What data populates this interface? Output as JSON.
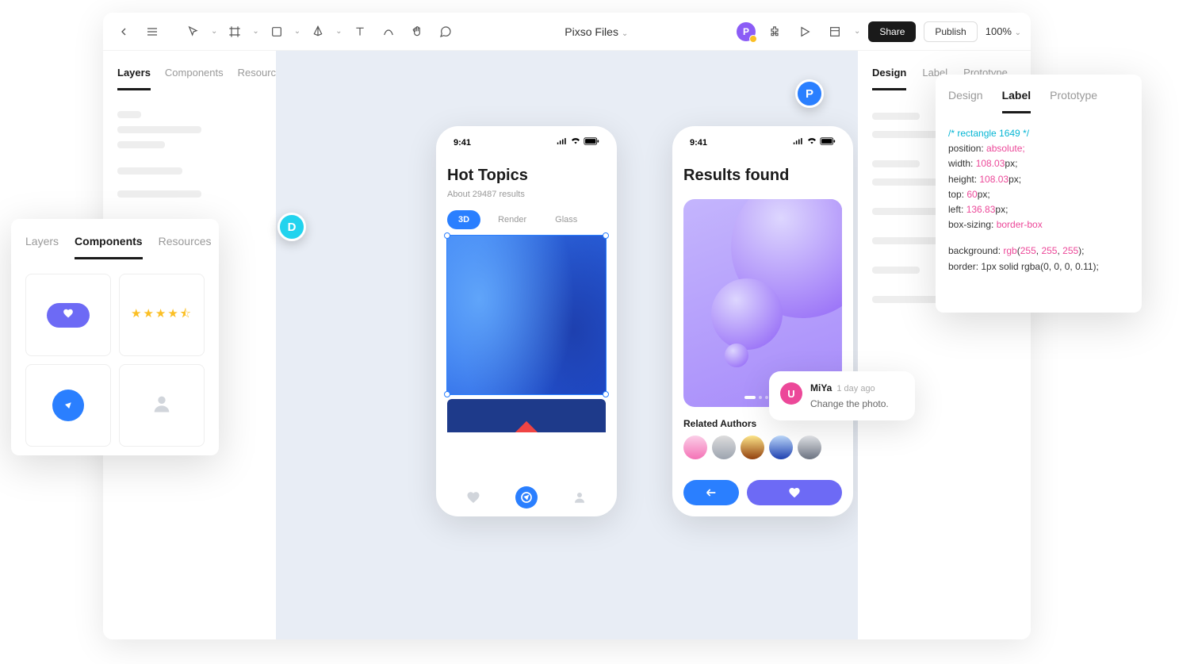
{
  "toolbar": {
    "title": "Pixso Files",
    "share": "Share",
    "publish": "Publish",
    "zoom": "100%"
  },
  "left_panel": {
    "tabs": [
      "Layers",
      "Components",
      "Resources"
    ],
    "active": 0
  },
  "right_panel": {
    "tabs": [
      "Design",
      "Label",
      "Prototype"
    ],
    "active": 0
  },
  "components_overlay": {
    "tabs": [
      "Layers",
      "Components",
      "Resources"
    ],
    "active": 1
  },
  "label_overlay": {
    "tabs": [
      "Design",
      "Label",
      "Prototype"
    ],
    "active": 1,
    "code": {
      "comment": "/* rectangle 1649 */",
      "l1a": "position: ",
      "l1b": "absolute;",
      "l2a": "width: ",
      "l2b": "108.03",
      "l2c": "px;",
      "l3a": "height: ",
      "l3b": "108.03",
      "l3c": "px;",
      "l4a": "top: ",
      "l4b": "60",
      "l4c": "px;",
      "l5a": "left: ",
      "l5b": "136.83",
      "l5c": "px;",
      "l6a": "box-sizing: ",
      "l6b": "border-box",
      "l7a": "background: ",
      "l7b": "rgb",
      "l7c": "(",
      "l7d": "255",
      "l7e": ", ",
      "l7f": "255",
      "l7g": ", ",
      "l7h": "255",
      "l7i": ");",
      "l8": "border: 1px solid rgba(0, 0, 0, 0.11);"
    }
  },
  "mockup1": {
    "time": "9:41",
    "title": "Hot Topics",
    "subtitle": "About 29487 results",
    "tabs": [
      "3D",
      "Render",
      "Glass"
    ]
  },
  "mockup2": {
    "time": "9:41",
    "title": "Results found",
    "related": "Related Authors"
  },
  "comment": {
    "initial": "U",
    "name": "MiYa",
    "time": "1 day ago",
    "text": "Change the photo."
  },
  "cursors": {
    "d": "D",
    "p": "P",
    "profile": "P"
  }
}
